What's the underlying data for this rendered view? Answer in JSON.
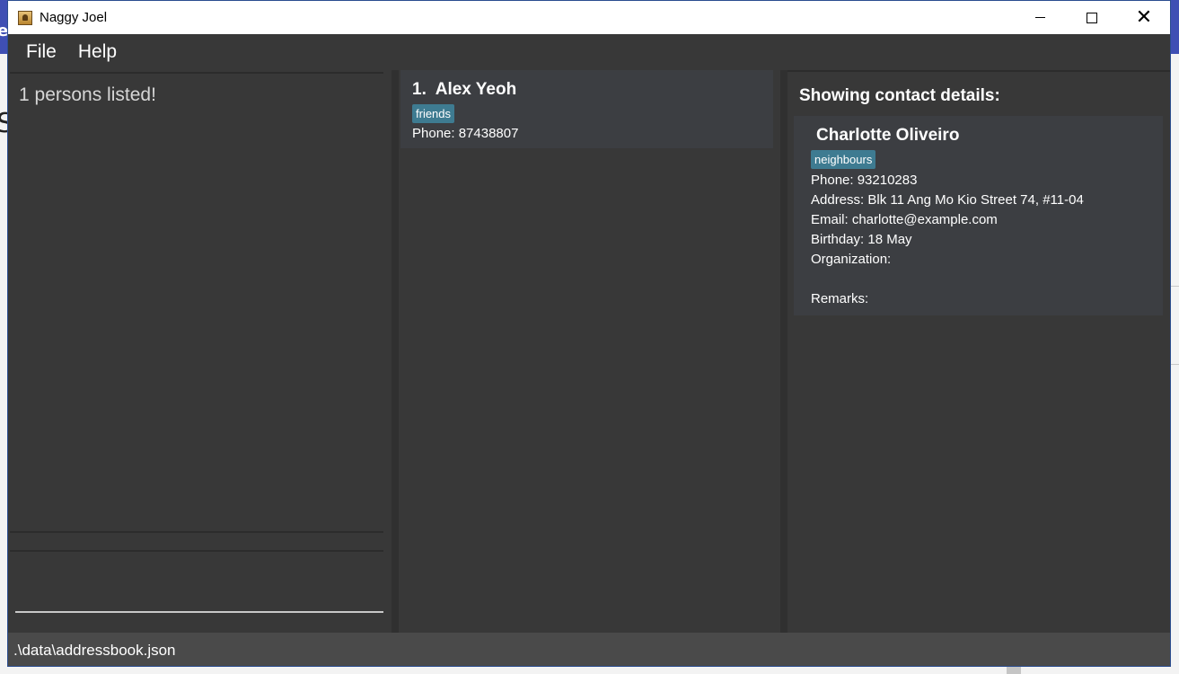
{
  "window": {
    "title": "Naggy Joel"
  },
  "menu": {
    "file": "File",
    "help": "Help"
  },
  "result": {
    "message": "1 persons listed!"
  },
  "command": {
    "value": "",
    "placeholder": ""
  },
  "person_list": [
    {
      "index": "1.",
      "name": "Alex Yeoh",
      "tags": [
        "friends"
      ],
      "phone": "Phone: 87438807"
    }
  ],
  "details": {
    "heading": "Showing contact details:",
    "name": "Charlotte Oliveiro",
    "tag": "neighbours",
    "phone": "Phone: 93210283",
    "address": "Address: Blk 11 Ang Mo Kio Street 74, #11-04",
    "email": "Email: charlotte@example.com",
    "birthday": "Birthday: 18 May",
    "organization": "Organization:",
    "blank": "",
    "remarks": "Remarks:"
  },
  "status": {
    "path": ".\\data\\addressbook.json"
  },
  "colors": {
    "background": "#383838",
    "card": "#3c3e42",
    "tag": "#3e7b91",
    "statusbar": "#4a4a4a"
  },
  "icons": {
    "app": "address-book-icon",
    "minimize": "minimize-icon",
    "maximize": "maximize-icon",
    "close": "close-icon"
  }
}
